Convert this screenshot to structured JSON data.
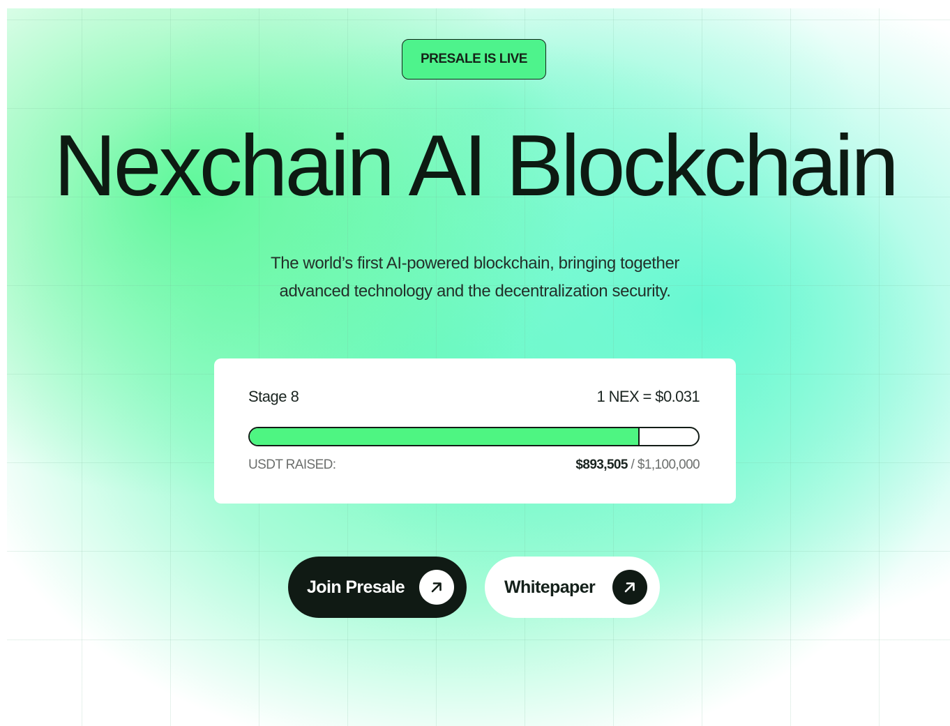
{
  "badge": {
    "label": "PRESALE IS LIVE"
  },
  "hero": {
    "title": "Nexchain AI Blockchain",
    "subtitle_line1": "The world’s first AI-powered blockchain, bringing together",
    "subtitle_line2": "advanced technology and the decentralization security."
  },
  "presale": {
    "stage": "Stage 8",
    "price": "1 NEX = $0.031",
    "raised_label": "USDT RAISED:",
    "raised_amount": "$893,505",
    "separator": " / ",
    "goal_amount": "$1,100,000",
    "progress_fraction": 0.87
  },
  "buttons": {
    "join_label": "Join Presale",
    "join_icon": "arrow-up-right-icon",
    "whitepaper_label": "Whitepaper",
    "whitepaper_icon": "arrow-up-right-icon"
  },
  "colors": {
    "accent_green": "#4ef582",
    "dark": "#101a14",
    "background_mint": "#6efabe"
  }
}
